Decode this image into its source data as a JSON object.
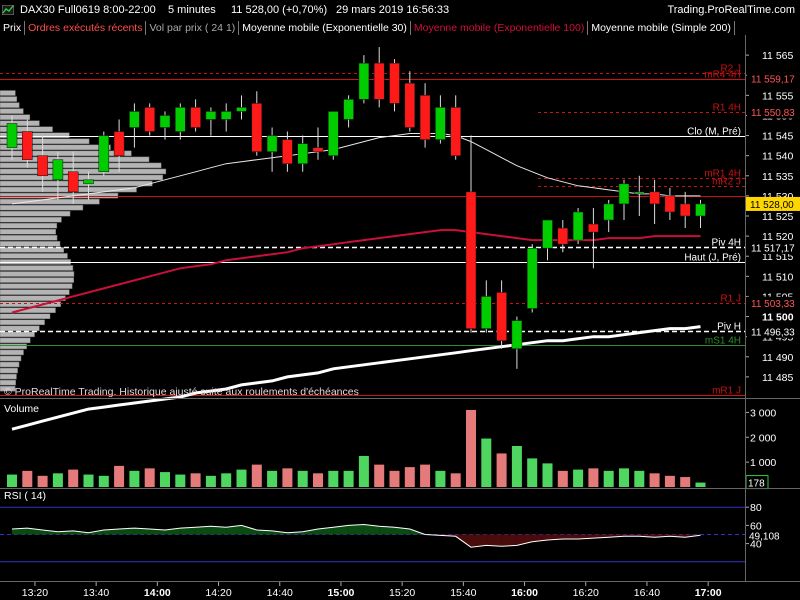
{
  "header": {
    "symbol": "DAX30 Full0619 8:00-22:00",
    "interval": "5 minutes",
    "price_change": "11 528,00 (+0,70%)",
    "datetime": "29 mars 2019 16:56:33",
    "site": "Trading.ProRealTime.com"
  },
  "legend": {
    "items": [
      {
        "label": "Prix",
        "color": "#ffffff"
      },
      {
        "label": "Ordres exécutés récents",
        "color": "#ff4d4d"
      },
      {
        "label": "Vol par prix ( 24 1)",
        "color": "#aaaaaa"
      },
      {
        "label": "Moyenne mobile (Exponentielle 30)",
        "color": "#ffffff"
      },
      {
        "label": "Moyenne mobile (Exponentielle 100)",
        "color": "#d0103a"
      },
      {
        "label": "Moyenne mobile (Simple 200)",
        "color": "#ffffff"
      }
    ]
  },
  "watermark": "© ProRealTime Trading. Historique ajusté suite aux roulements d'échéances",
  "panels": {
    "volume_title": "Volume",
    "rsi_title": "RSI ( 14)"
  },
  "colors": {
    "up": "#00cc00",
    "down": "#ff1a1a",
    "vol_up": "#4ed660",
    "vol_down": "#e47a7a",
    "ema100": "#c8103a",
    "level_red": "#cc1111",
    "rsi_fill_up": "#0b4a12",
    "rsi_fill_down": "#4a0b0b",
    "rsi_band": "#3333cc"
  },
  "chart_data": {
    "type": "candlestick",
    "timeframe": "5 minutes",
    "price_axis": {
      "ylim": [
        11480,
        11570
      ],
      "ticks": [
        "11 565",
        "11 560",
        "11 555",
        "11 550",
        "11 545",
        "11 540",
        "11 535",
        "11 530",
        "11 525",
        "11 520",
        "11 515",
        "11 510",
        "11 505",
        "11 500",
        "11 495",
        "11 490",
        "11 485"
      ],
      "tick_values": [
        11565,
        11560,
        11555,
        11550,
        11545,
        11540,
        11535,
        11530,
        11525,
        11520,
        11515,
        11510,
        11505,
        11500,
        11495,
        11490,
        11485
      ],
      "bold_tick": "11 500"
    },
    "time_axis": {
      "labels": [
        "13:20",
        "13:40",
        "14:00",
        "14:20",
        "14:40",
        "15:00",
        "15:20",
        "15:40",
        "16:00",
        "16:20",
        "16:40",
        "17:00"
      ],
      "bold": [
        "14:00",
        "15:00",
        "16:00",
        "17:00"
      ]
    },
    "candles": [
      {
        "o": 11542,
        "h": 11550,
        "l": 11539,
        "c": 11548
      },
      {
        "o": 11546,
        "h": 11549,
        "l": 11537,
        "c": 11539
      },
      {
        "o": 11540,
        "h": 11545,
        "l": 11531,
        "c": 11535
      },
      {
        "o": 11534,
        "h": 11541,
        "l": 11529,
        "c": 11539
      },
      {
        "o": 11536,
        "h": 11541,
        "l": 11528,
        "c": 11531
      },
      {
        "o": 11533,
        "h": 11536,
        "l": 11529,
        "c": 11534
      },
      {
        "o": 11536,
        "h": 11546,
        "l": 11535,
        "c": 11545
      },
      {
        "o": 11546,
        "h": 11549,
        "l": 11536,
        "c": 11540
      },
      {
        "o": 11547,
        "h": 11553,
        "l": 11542,
        "c": 11551
      },
      {
        "o": 11552,
        "h": 11553,
        "l": 11545,
        "c": 11546
      },
      {
        "o": 11547,
        "h": 11551,
        "l": 11544,
        "c": 11550
      },
      {
        "o": 11546,
        "h": 11553,
        "l": 11544,
        "c": 11552
      },
      {
        "o": 11552,
        "h": 11554,
        "l": 11546,
        "c": 11547
      },
      {
        "o": 11549,
        "h": 11552,
        "l": 11545,
        "c": 11551
      },
      {
        "o": 11549,
        "h": 11553,
        "l": 11546,
        "c": 11551
      },
      {
        "o": 11551,
        "h": 11555,
        "l": 11549,
        "c": 11552
      },
      {
        "o": 11553,
        "h": 11556,
        "l": 11540,
        "c": 11541
      },
      {
        "o": 11541,
        "h": 11547,
        "l": 11536,
        "c": 11545
      },
      {
        "o": 11544,
        "h": 11546,
        "l": 11536,
        "c": 11538
      },
      {
        "o": 11538,
        "h": 11545,
        "l": 11536,
        "c": 11543
      },
      {
        "o": 11542,
        "h": 11547,
        "l": 11539,
        "c": 11541
      },
      {
        "o": 11540,
        "h": 11551,
        "l": 11539,
        "c": 11551
      },
      {
        "o": 11549,
        "h": 11555,
        "l": 11547,
        "c": 11554
      },
      {
        "o": 11554,
        "h": 11565,
        "l": 11553,
        "c": 11563
      },
      {
        "o": 11563,
        "h": 11567,
        "l": 11552,
        "c": 11554
      },
      {
        "o": 11563,
        "h": 11564,
        "l": 11551,
        "c": 11553
      },
      {
        "o": 11558,
        "h": 11561,
        "l": 11546,
        "c": 11547
      },
      {
        "o": 11555,
        "h": 11558,
        "l": 11542,
        "c": 11544
      },
      {
        "o": 11544,
        "h": 11555,
        "l": 11543,
        "c": 11552
      },
      {
        "o": 11552,
        "h": 11555,
        "l": 11539,
        "c": 11540
      },
      {
        "o": 11531,
        "h": 11545,
        "l": 11496,
        "c": 11497
      },
      {
        "o": 11497,
        "h": 11509,
        "l": 11496,
        "c": 11505
      },
      {
        "o": 11506,
        "h": 11509,
        "l": 11492,
        "c": 11494
      },
      {
        "o": 11492,
        "h": 11500,
        "l": 11487,
        "c": 11499
      },
      {
        "o": 11502,
        "h": 11518,
        "l": 11501,
        "c": 11517
      },
      {
        "o": 11517,
        "h": 11524,
        "l": 11514,
        "c": 11524
      },
      {
        "o": 11522,
        "h": 11524,
        "l": 11516,
        "c": 11518
      },
      {
        "o": 11519,
        "h": 11527,
        "l": 11518,
        "c": 11526
      },
      {
        "o": 11523,
        "h": 11527,
        "l": 11512,
        "c": 11521
      },
      {
        "o": 11524,
        "h": 11529,
        "l": 11521,
        "c": 11528
      },
      {
        "o": 11528,
        "h": 11534,
        "l": 11524,
        "c": 11533
      },
      {
        "o": 11531,
        "h": 11535,
        "l": 11525,
        "c": 11531
      },
      {
        "o": 11531,
        "h": 11534,
        "l": 11523,
        "c": 11528
      },
      {
        "o": 11530,
        "h": 11532,
        "l": 11524,
        "c": 11526
      },
      {
        "o": 11528,
        "h": 11531,
        "l": 11522,
        "c": 11525
      },
      {
        "o": 11525,
        "h": 11529,
        "l": 11522,
        "c": 11528
      }
    ],
    "ema30": [
      11528,
      11528.5,
      11529,
      11529.5,
      11530,
      11530.5,
      11531,
      11531.5,
      11532,
      11533,
      11534,
      11535,
      11536,
      11537,
      11538,
      11538.5,
      11539,
      11539.5,
      11540,
      11540.5,
      11541,
      11541.5,
      11542.5,
      11543.5,
      11544.5,
      11545,
      11545.5,
      11545.5,
      11545.5,
      11545,
      11543.5,
      11541.5,
      11539.5,
      11537.5,
      11536,
      11534.5,
      11533.5,
      11532.5,
      11532,
      11531.5,
      11531,
      11530.5,
      11530.5,
      11530,
      11530,
      11530
    ],
    "ema100": [
      11501,
      11502,
      11503,
      11504,
      11505,
      11506,
      11507,
      11508,
      11509,
      11510,
      11511,
      11512,
      11512.5,
      11513,
      11514,
      11514.5,
      11515,
      11515.5,
      11516,
      11517,
      11517.5,
      11518,
      11518.5,
      11519,
      11519.5,
      11520,
      11520.5,
      11521,
      11521.5,
      11521.5,
      11521,
      11520.5,
      11520,
      11519.5,
      11519,
      11519,
      11519,
      11519,
      11519,
      11519.5,
      11519.5,
      11519.5,
      11520,
      11520,
      11520,
      11520
    ],
    "sma200": [
      11472,
      11473,
      11474,
      11475,
      11476,
      11477,
      11477.5,
      11478,
      11478.5,
      11479,
      11479.5,
      11480,
      11481,
      11481.5,
      11482,
      11483,
      11483.5,
      11484,
      11485,
      11485.5,
      11486,
      11487,
      11487.5,
      11488,
      11488.5,
      11489,
      11489.5,
      11490,
      11490.5,
      11491,
      11491.5,
      11492,
      11492.5,
      11493,
      11493.5,
      11494,
      11494,
      11494.5,
      11495,
      11495,
      11495.5,
      11496,
      11496.5,
      11497,
      11497,
      11497.5
    ],
    "levels": [
      {
        "label": "R2 J",
        "value": 11560.5,
        "style": "dashed",
        "color": "#cc1111",
        "text_color": "#cc1111"
      },
      {
        "label": "mR4 4H",
        "value": 11559.17,
        "price_tag": "11 559,17",
        "style": "solid",
        "color": "#cc1111",
        "text_color": "#cc1111"
      },
      {
        "label": "R1 4H",
        "value": 11550.83,
        "price_tag": "11 550,83",
        "style": "dashed",
        "color": "#cc1111",
        "text_color": "#cc1111"
      },
      {
        "label": "Clo (M, Pré)",
        "value": 11545,
        "style": "solid",
        "color": "#ffffff",
        "text_color": "#ffffff"
      },
      {
        "label": "mR1 4H",
        "value": 11534.5,
        "style": "dashed",
        "color": "#cc1111",
        "text_color": "#cc1111"
      },
      {
        "label": "mR2 J",
        "value": 11532.5,
        "style": "dashed",
        "color": "#cc1111",
        "text_color": "#cc1111"
      },
      {
        "label": "",
        "value": 11530,
        "style": "solid",
        "color": "#cc1111",
        "text_color": "#cc1111"
      },
      {
        "label": "Piv 4H",
        "value": 11517.17,
        "price_tag": "11 517,17",
        "style": "dashed",
        "color": "#ffffff",
        "text_color": "#ffffff"
      },
      {
        "label": "Haut (J, Pré)",
        "value": 11513.5,
        "style": "solid",
        "color": "#ffffff",
        "text_color": "#ffffff"
      },
      {
        "label": "R1 J",
        "value": 11503.33,
        "price_tag": "11 503,33",
        "style": "dashed",
        "color": "#cc1111",
        "text_color": "#cc1111"
      },
      {
        "label": "Piv H",
        "value": 11496.33,
        "price_tag": "11 496,33",
        "style": "dashed",
        "color": "#ffffff",
        "text_color": "#ffffff"
      },
      {
        "label": "mS1 4H",
        "value": 11493,
        "style": "solid",
        "color": "#2e8b2e",
        "text_color": "#2e8b2e"
      },
      {
        "label": "mR1 J",
        "value": 11480.5,
        "style": "solid",
        "color": "#cc1111",
        "text_color": "#cc1111"
      }
    ],
    "current_price": {
      "value": 11528,
      "label": "11 528,00"
    },
    "volume": {
      "ylim": [
        0,
        3500
      ],
      "ticks": [
        "3 000",
        "2 000",
        "1 000"
      ],
      "tick_values": [
        3000,
        2000,
        1000
      ],
      "current_label": "178",
      "values": [
        500,
        650,
        450,
        550,
        700,
        500,
        450,
        850,
        650,
        750,
        600,
        500,
        550,
        450,
        550,
        700,
        900,
        650,
        750,
        650,
        550,
        650,
        650,
        1250,
        900,
        650,
        800,
        900,
        650,
        550,
        3100,
        1950,
        1350,
        1650,
        1150,
        950,
        650,
        700,
        750,
        650,
        750,
        650,
        550,
        450,
        400,
        178
      ]
    },
    "rsi": {
      "period": 14,
      "ylim": [
        0,
        100
      ],
      "ticks": [
        "80",
        "60",
        "40"
      ],
      "tick_values": [
        80,
        60,
        40
      ],
      "current_label": "49,108",
      "values": [
        56,
        57,
        55,
        53,
        54,
        52,
        55,
        56,
        57,
        56,
        55,
        57,
        58,
        59,
        58,
        60,
        55,
        54,
        52,
        53,
        56,
        58,
        60,
        61,
        59,
        58,
        56,
        50,
        49,
        48,
        36,
        38,
        37,
        38,
        42,
        44,
        45,
        45,
        46,
        47,
        48,
        48,
        47,
        48,
        47,
        49.1
      ]
    }
  }
}
